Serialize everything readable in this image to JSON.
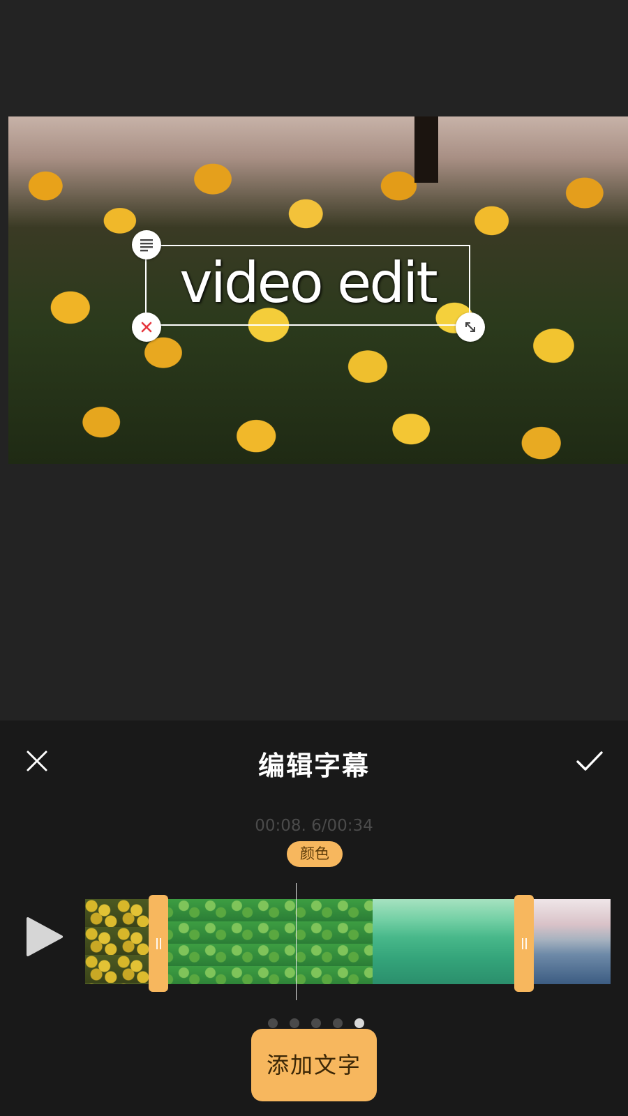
{
  "preview": {
    "sticker_text": "video edit"
  },
  "icons": {
    "edit": "text-align-icon",
    "delete": "close-icon",
    "scale": "resize-icon",
    "close": "close-icon",
    "confirm": "check-icon",
    "play": "play-icon"
  },
  "toolbar": {
    "title": "编辑字幕"
  },
  "timeline": {
    "timecode": "00:08. 6/00:34",
    "color_tag": "颜色",
    "page_count": 5,
    "active_page": 5
  },
  "actions": {
    "add_text": "添加文字"
  },
  "colors": {
    "accent": "#f7b75e",
    "background": "#232323",
    "panel": "#191919",
    "delete_red": "#e5373e"
  }
}
